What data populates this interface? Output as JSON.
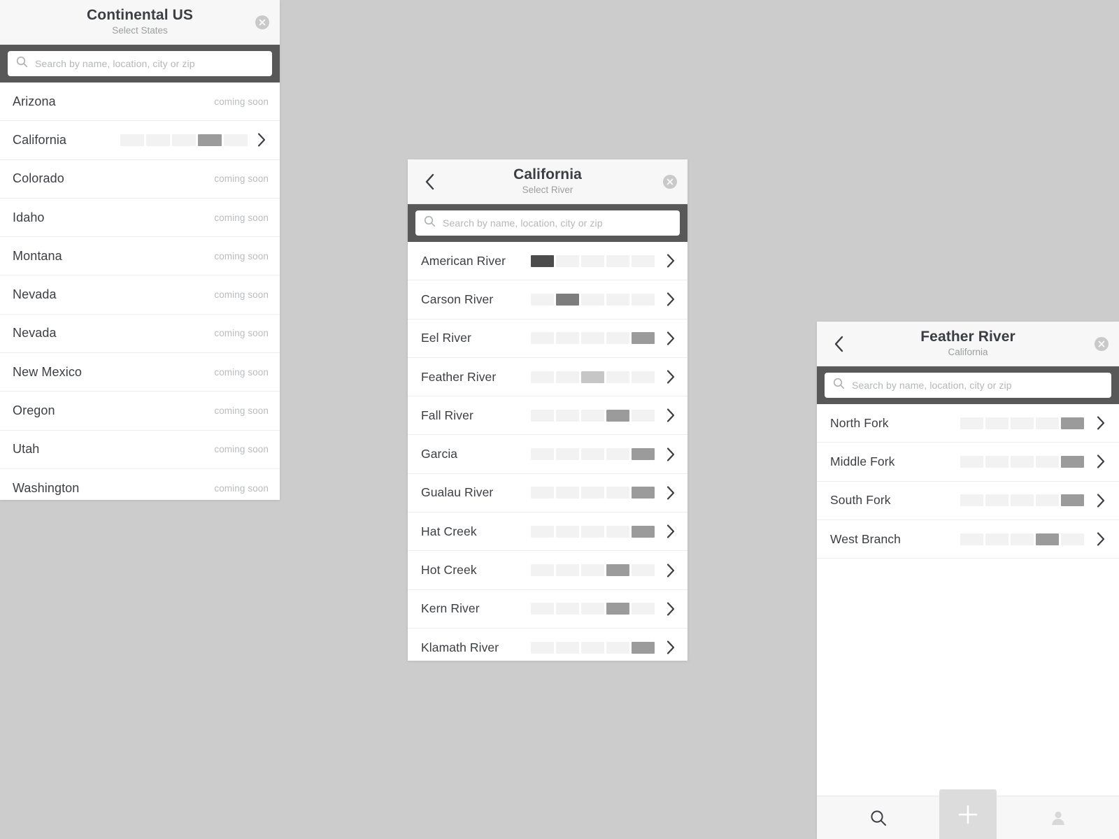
{
  "background_color": "#cccccc",
  "accent_colors": {
    "search_band": "#585858",
    "panel_header": "#f7f7f7",
    "text_primary": "#3b3e42",
    "text_muted": "#b9bcbf",
    "meter_off": "#f2f2f2",
    "meter_level_1": "#4c4c4c",
    "meter_level_2": "#7d7d7d",
    "meter_level_3": "#c6c6c6",
    "meter_level_4": "#9b9b9b",
    "meter_level_5": "#9b9b9b"
  },
  "search": {
    "placeholder": "Search by name, location, city or zip",
    "value": "",
    "icon": "search-icon"
  },
  "states_panel": {
    "title": "Continental US",
    "subtitle": "Select States",
    "close_icon": "close-circle-icon",
    "coming_soon_label": "coming soon",
    "meter_segments": 5,
    "rows": [
      {
        "label": "Arizona",
        "status": "coming soon",
        "level": 0
      },
      {
        "label": "California",
        "status": "",
        "level": 4
      },
      {
        "label": "Colorado",
        "status": "coming soon",
        "level": 0
      },
      {
        "label": "Idaho",
        "status": "coming soon",
        "level": 0
      },
      {
        "label": "Montana",
        "status": "coming soon",
        "level": 0
      },
      {
        "label": "Nevada",
        "status": "coming soon",
        "level": 0
      },
      {
        "label": "Nevada",
        "status": "coming soon",
        "level": 0
      },
      {
        "label": "New Mexico",
        "status": "coming soon",
        "level": 0
      },
      {
        "label": "Oregon",
        "status": "coming soon",
        "level": 0
      },
      {
        "label": "Utah",
        "status": "coming soon",
        "level": 0
      },
      {
        "label": "Washington",
        "status": "coming soon",
        "level": 0
      }
    ]
  },
  "rivers_panel": {
    "title": "California",
    "subtitle": "Select River",
    "back_icon": "chevron-left-icon",
    "close_icon": "close-circle-icon",
    "meter_segments": 5,
    "rows": [
      {
        "label": "American River",
        "status": "",
        "level": 1
      },
      {
        "label": "Carson River",
        "status": "",
        "level": 2
      },
      {
        "label": "Eel River",
        "status": "",
        "level": 5
      },
      {
        "label": "Feather River",
        "status": "",
        "level": 3
      },
      {
        "label": "Fall River",
        "status": "",
        "level": 4
      },
      {
        "label": "Garcia",
        "status": "",
        "level": 5
      },
      {
        "label": "Gualau River",
        "status": "",
        "level": 5
      },
      {
        "label": "Hat Creek",
        "status": "",
        "level": 5
      },
      {
        "label": "Hot Creek",
        "status": "",
        "level": 4
      },
      {
        "label": "Kern River",
        "status": "",
        "level": 4
      },
      {
        "label": "Klamath River",
        "status": "",
        "level": 5
      }
    ]
  },
  "forks_panel": {
    "title": "Feather River",
    "subtitle": "California",
    "back_icon": "chevron-left-icon",
    "close_icon": "close-circle-icon",
    "meter_segments": 5,
    "rows": [
      {
        "label": "North Fork",
        "status": "",
        "level": 5
      },
      {
        "label": "Middle Fork",
        "status": "",
        "level": 5
      },
      {
        "label": "South Fork",
        "status": "",
        "level": 5
      },
      {
        "label": "West Branch",
        "status": "",
        "level": 4
      }
    ],
    "tabbar": {
      "tabs": [
        {
          "name": "search-tab",
          "icon": "search-icon",
          "active": true
        },
        {
          "name": "add-tab",
          "icon": "plus-icon",
          "active": false
        },
        {
          "name": "profile-tab",
          "icon": "person-icon",
          "active": false
        }
      ]
    }
  }
}
